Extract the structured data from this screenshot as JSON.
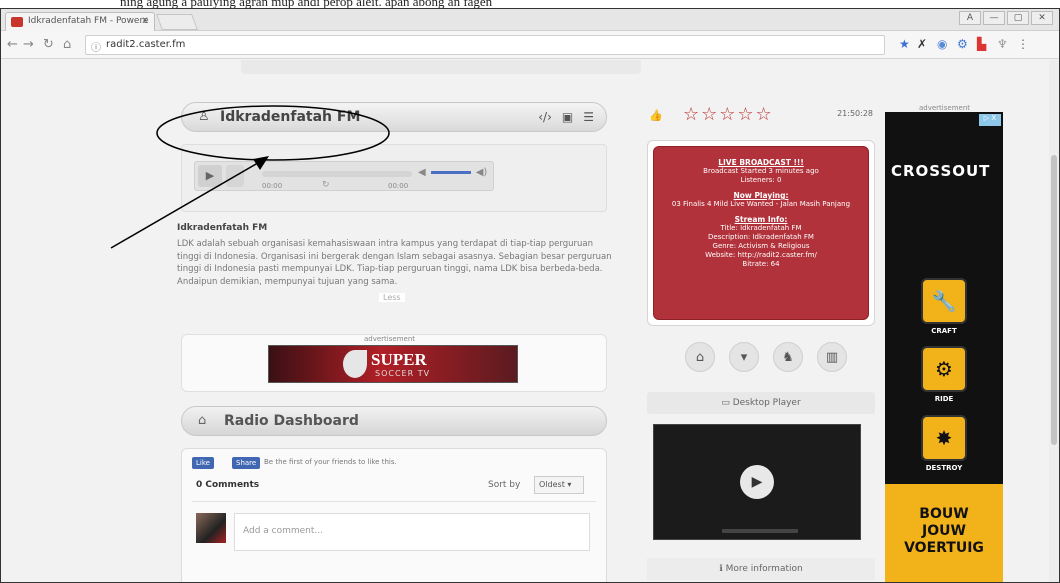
{
  "caption_fragment": "ning agung a paulying  agran mup andi perop aleit. apan abong an fagen",
  "browser": {
    "tab_title": "Idkradenfatah FM - Powere",
    "tab_close": "x",
    "window_controls": [
      "A",
      "—",
      "▢",
      "✕"
    ],
    "url": "radit2.caster.fm"
  },
  "player": {
    "station_name": "Idkradenfatah FM",
    "time_left": "00:00",
    "time_right": "00:00"
  },
  "description": {
    "title": "Idkradenfatah FM",
    "text": "LDK adalah sebuah organisasi kemahasiswaan intra kampus yang terdapat di tiap-tiap perguruan tinggi di Indonesia. Organisasi ini bergerak dengan Islam sebagai asasnya. Sebagian besar perguruan tinggi di Indonesia pasti mempunyai LDK. Tiap-tiap perguruan tinggi, nama LDK bisa berbeda-beda. Andaipun demikian, mempunyai tujuan yang sama.",
    "more": "Less"
  },
  "advertisement_label": "advertisement",
  "ad_banner": {
    "title": "SUPER",
    "subtitle": "SOCCER TV"
  },
  "dashboard": {
    "title": "Radio Dashboard",
    "fb_like": "Like",
    "fb_share": "Share",
    "fb_text": "Be the first of your friends to like this.",
    "comment_count": "0 Comments",
    "sort_label": "Sort by",
    "sort_value": "Oldest ▾",
    "comment_placeholder": "Add a comment..."
  },
  "rating": {
    "stars": "☆☆☆☆☆",
    "time": "21:50:28"
  },
  "live": {
    "heading": "LIVE BROADCAST !!!",
    "started": "Broadcast Started 3 minutes ago",
    "listeners": "Listeners: 0",
    "now_playing_heading": "Now Playing:",
    "now_playing": "03 Finalis 4 Mild Live Wanted - Jalan Masih Panjang",
    "stream_heading": "Stream Info:",
    "title_line": "Title: Idkradenfatah FM",
    "description_line": "Description: Idkradenfatah FM",
    "genre_line": "Genre: Activism & Religious",
    "website_line": "Website: http://radit2.caster.fm/",
    "bitrate_line": "Bitrate: 64"
  },
  "desktop_player": "Desktop Player",
  "more_information": "More information",
  "sky_ad": {
    "brand": "CROSSOUT",
    "ad_choice": "▷ X",
    "craft": "CRAFT",
    "ride": "RIDE",
    "destroy": "DESTROY",
    "cta": [
      "BOUW",
      "JOUW",
      "VOERTUIG"
    ]
  }
}
